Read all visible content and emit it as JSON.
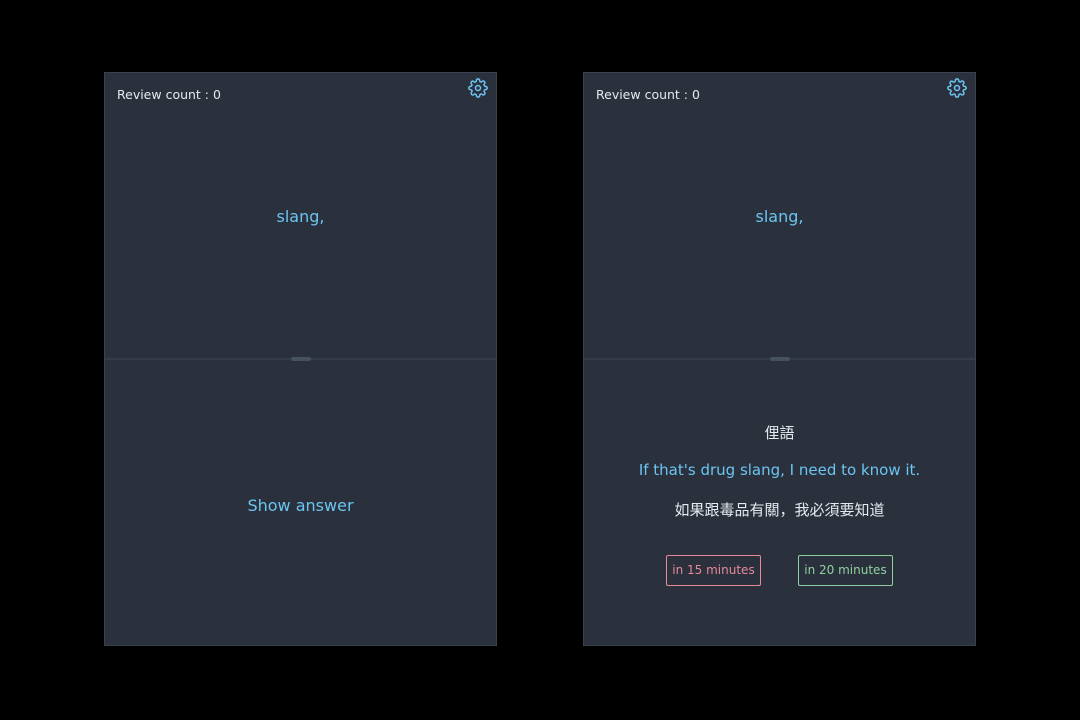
{
  "colors": {
    "background": "#000000",
    "card": "#2a313d",
    "accent_blue": "#6cc4f2",
    "text": "#e6e9ee",
    "again_red": "#e8899a",
    "good_green": "#8fd19e"
  },
  "left_card": {
    "review_count_label": "Review count : 0",
    "settings_icon": "gear-icon",
    "word": "slang,",
    "show_answer_label": "Show answer"
  },
  "right_card": {
    "review_count_label": "Review count : 0",
    "settings_icon": "gear-icon",
    "word": "slang,",
    "meaning": "俚語",
    "example_en": "If that's drug slang, I need to know it.",
    "example_zh": "如果跟毒品有關，我必須要知道",
    "buttons": {
      "again_label": "in 15 minutes",
      "good_label": "in 20 minutes"
    }
  }
}
